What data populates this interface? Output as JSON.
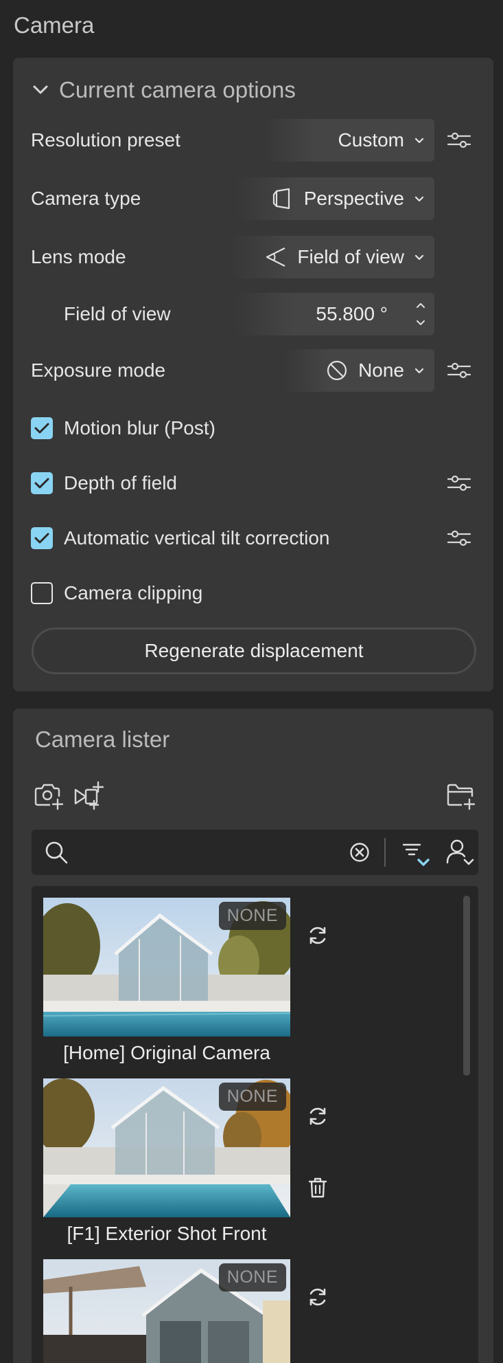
{
  "window": {
    "title": "Camera"
  },
  "options": {
    "header": "Current camera options",
    "resolution": {
      "label": "Resolution preset",
      "value": "Custom"
    },
    "camera_type": {
      "label": "Camera type",
      "value": "Perspective"
    },
    "lens_mode": {
      "label": "Lens mode",
      "value": "Field of view"
    },
    "fov": {
      "label": "Field of view",
      "value": "55.800 °"
    },
    "exposure": {
      "label": "Exposure mode",
      "value": "None"
    },
    "checks": [
      {
        "label": "Motion blur (Post)",
        "checked": true
      },
      {
        "label": "Depth of field",
        "checked": true
      },
      {
        "label": "Automatic vertical tilt correction",
        "checked": true
      },
      {
        "label": "Camera clipping",
        "checked": false
      }
    ],
    "regen_label": "Regenerate displacement"
  },
  "lister": {
    "title": "Camera lister",
    "search": {
      "value": "",
      "placeholder": ""
    },
    "cameras": [
      {
        "name": "[Home] Original Camera",
        "badge": "NONE"
      },
      {
        "name": "[F1] Exterior Shot Front",
        "badge": "NONE"
      },
      {
        "name": "",
        "badge": "NONE"
      }
    ]
  },
  "colors": {
    "accent": "#8ad4f3",
    "panel": "#373737",
    "background": "#262626"
  }
}
